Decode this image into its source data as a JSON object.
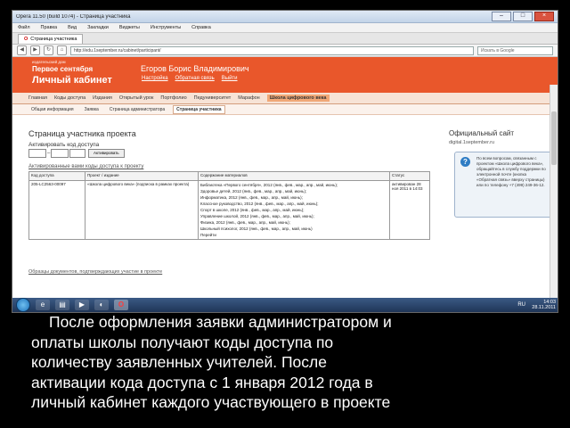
{
  "browser": {
    "window_title": "Opera 11.50 (build 1074) - Страница участника",
    "menu": [
      "Файл",
      "Правка",
      "Вид",
      "Закладки",
      "Виджеты",
      "Инструменты",
      "Справка"
    ],
    "tab_label": "Страница участника",
    "address": "http://edu.1september.ru/cabinet/participant/",
    "search_placeholder": "Искать в Google",
    "window_buttons": {
      "minimize": "–",
      "maximize": "□",
      "close": "×"
    }
  },
  "site": {
    "logo_small": "издательский дом",
    "logo_brand": "Первое сентября",
    "logo_main": "Личный кабинет",
    "user_name": "Егоров Борис Владимирович",
    "user_links": [
      "Настройка",
      "Обратная связь",
      "Выйти"
    ],
    "nav": [
      "Главная",
      "Коды доступа",
      "Издания",
      "Открытый урок",
      "Портфолио",
      "Педуниверситет",
      "Марафон",
      "Школа цифрового века"
    ],
    "nav_active_index": 7,
    "subnav": [
      "Общая информация",
      "Заявка",
      "Страница администратора",
      "Страница участника"
    ],
    "subnav_active_index": 3
  },
  "page": {
    "title": "Страница участника проекта",
    "activate_label": "Активировать код доступа",
    "activate_button": "Активировать",
    "used_heading": "Активированные вами коды доступа к проекту",
    "table": {
      "headers": [
        "Код доступа",
        "Проект / издание",
        "Содержание материалов",
        "Статус"
      ],
      "row": {
        "code": "205-LC2563-00097",
        "project": "«Школа цифрового века» (подписка в рамках проекта)",
        "materials": [
          "Библиотека «Первого сентября», 2012 (янв., фев., мар., апр., май, июнь);",
          "Здоровье детей, 2012 (янв., фев., мар., апр., май, июнь);",
          "Информатика, 2012 (янв., фев., мар., апр., май, июнь);",
          "Классное руководство, 2012 (янв., фев., мар., апр., май, июнь);",
          "Спорт в школе, 2012 (янв., фев., мар., апр., май, июнь);",
          "Управление школой, 2012 (янв., фев., мар., апр., май, июнь);",
          "Физика, 2012 (янв., фев., мар., апр., май, июнь);",
          "Школьный психолог, 2012 (янв., фев., мар., апр., май, июнь)",
          "Перейти"
        ],
        "status": "активирован 28 ноя 2011 в 14:03"
      }
    },
    "docs_link": "Образцы документов, подтверждающих участие в проекте",
    "official_title": "Официальный сайт",
    "official_url": "digital.1september.ru",
    "info_text": "По всем вопросам, связанным с проектом «Школа цифрового века», обращайтесь в службу поддержки по электронной почте (кнопка «Обратная связь» вверху страницы) или по телефону +7 (499) 249-36-12."
  },
  "taskbar": {
    "language": "RU",
    "time": "14:03",
    "date": "28.11.2011"
  },
  "caption": {
    "lines": [
      "После оформления заявки администратором  и",
      "оплаты школы получают коды доступа по",
      "количеству заявленных  учителей.  После",
      "активации кода доступа с 1 января 2012 года в",
      "личный кабинет каждого участвующего в проекте"
    ]
  }
}
